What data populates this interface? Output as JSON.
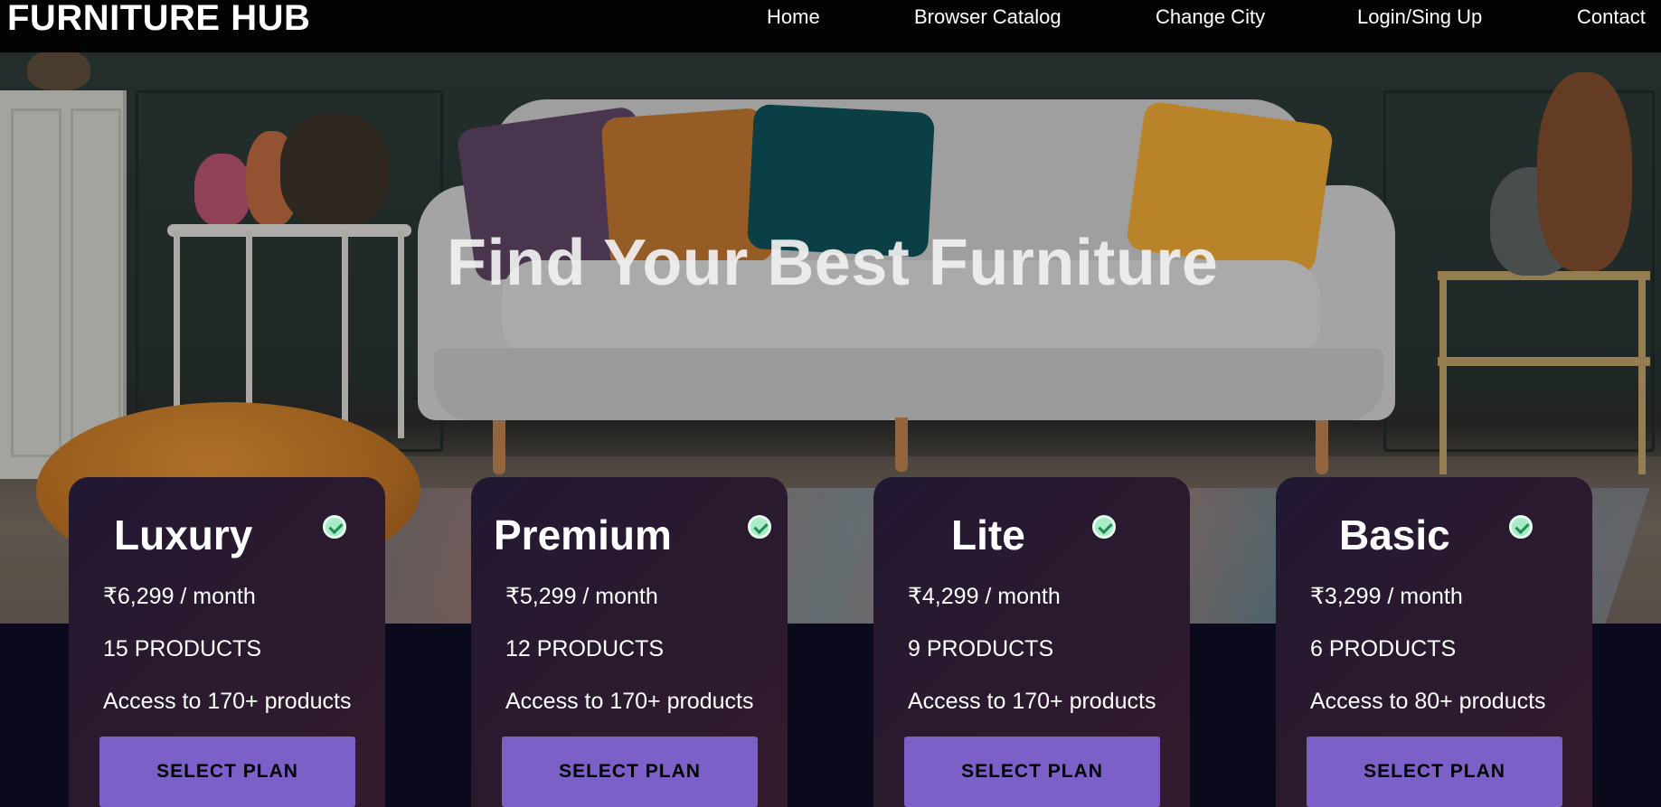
{
  "brand": "FURNITURE HUB",
  "nav": {
    "home": "Home",
    "catalog": "Browser Catalog",
    "city": "Change City",
    "login": "Login/Sing Up",
    "contact": "Contact"
  },
  "hero": {
    "title": "Find Your Best Furniture"
  },
  "plans": [
    {
      "name": "Luxury",
      "price": "₹6,299 / month",
      "products": "15 PRODUCTS",
      "access": "Access to 170+ products",
      "button": "SELECT PLAN"
    },
    {
      "name": "Premium",
      "price": "₹5,299 / month",
      "products": "12 PRODUCTS",
      "access": "Access to 170+ products",
      "button": "SELECT PLAN"
    },
    {
      "name": "Lite",
      "price": "₹4,299 / month",
      "products": "9 PRODUCTS",
      "access": "Access to 170+ products",
      "button": "SELECT PLAN"
    },
    {
      "name": "Basic",
      "price": "₹3,299 / month",
      "products": "6 PRODUCTS",
      "access": "Access to 80+ products",
      "button": "SELECT PLAN"
    }
  ],
  "colors": {
    "nav_bg": "#000000",
    "band_bg": "#0b0a1c",
    "card_bg": "#2a1a30",
    "button": "#7a60c7",
    "check": "#a6ecc6"
  },
  "icons": {
    "plan_badge": "check-circle-icon"
  }
}
